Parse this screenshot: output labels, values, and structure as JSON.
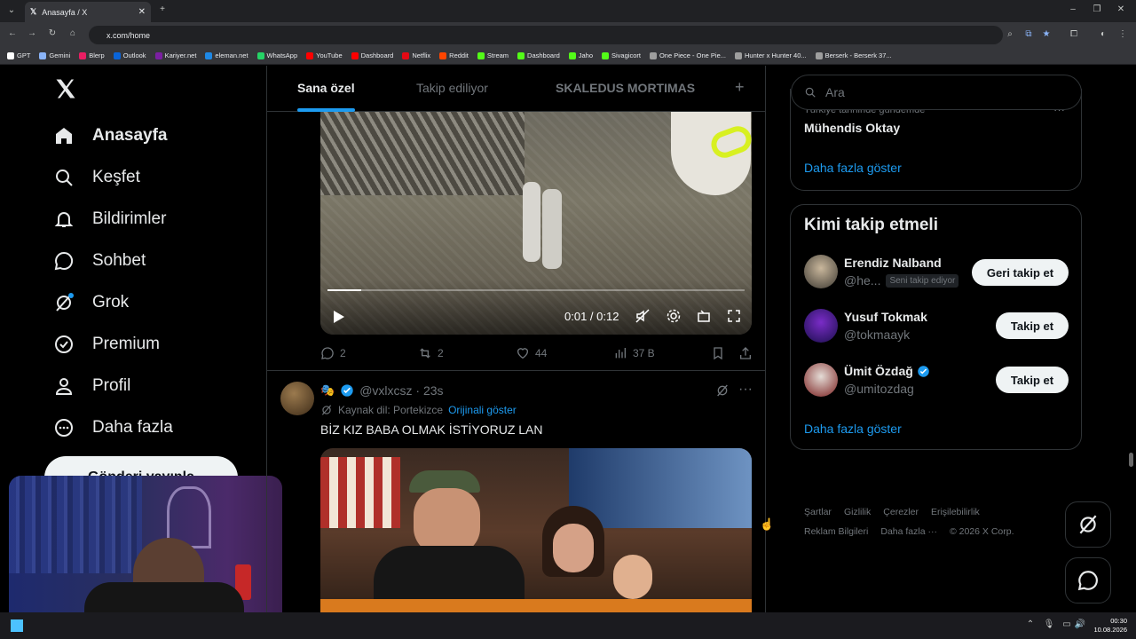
{
  "browser": {
    "tab_title": "Anasayfa / X",
    "url": "x.com/home",
    "bookmarks": [
      {
        "label": "GPT",
        "color": "#ffffff"
      },
      {
        "label": "Gemini",
        "color": "#8ab4f8"
      },
      {
        "label": "Blerp",
        "color": "#e91e63"
      },
      {
        "label": "Outlook",
        "color": "#0a64d8"
      },
      {
        "label": "Kariyer.net",
        "color": "#7b1fa2"
      },
      {
        "label": "eleman.net",
        "color": "#1e88e5"
      },
      {
        "label": "WhatsApp",
        "color": "#25d366"
      },
      {
        "label": "YouTube",
        "color": "#ff0000"
      },
      {
        "label": "Dashboard",
        "color": "#ff0000"
      },
      {
        "label": "Netflix",
        "color": "#e50914"
      },
      {
        "label": "Reddit",
        "color": "#ff4500"
      },
      {
        "label": "Stream",
        "color": "#53fc18"
      },
      {
        "label": "Dashboard",
        "color": "#53fc18"
      },
      {
        "label": "Jaho",
        "color": "#53fc18"
      },
      {
        "label": "Sivagicort",
        "color": "#53fc18"
      },
      {
        "label": "One Piece - One Pie...",
        "color": "#9e9e9e"
      },
      {
        "label": "Hunter x Hunter 40...",
        "color": "#9e9e9e"
      },
      {
        "label": "Berserk - Berserk 37...",
        "color": "#9e9e9e"
      }
    ]
  },
  "nav": {
    "home": "Anasayfa",
    "explore": "Keşfet",
    "notifications": "Bildirimler",
    "chat": "Sohbet",
    "grok": "Grok",
    "premium": "Premium",
    "profile": "Profil",
    "more": "Daha fazla",
    "post_button": "Gönderi yayınla"
  },
  "timeline_tabs": {
    "for_you": "Sana özel",
    "following": "Takip ediliyor",
    "list": "SKALEDUS MORTIMAS"
  },
  "post1": {
    "video_time": "0:01 / 0:12",
    "progress": 0.08,
    "replies": "2",
    "reposts": "2",
    "likes": "44",
    "views": "37 B"
  },
  "post2": {
    "handle": "@vxlxcsz · 23s",
    "source_lang": "Kaynak dil: Portekizce",
    "show_original": "Orijinali göster",
    "text": "BİZ KIZ BABA OLMAK İSTİYORUZ LAN"
  },
  "sidebar": {
    "search_placeholder": "Ara",
    "trend_context": "Türkiye tarihinde gündemde",
    "trend_name": "Mühendis Oktay",
    "show_more_1": "Daha fazla göster",
    "wtf_title": "Kimi takip etmeli",
    "suggestions": [
      {
        "name": "Erendiz Nalband",
        "handle": "@he...",
        "badge": "Seni takip ediyor",
        "button": "Geri takip et"
      },
      {
        "name": "Yusuf Tokmak",
        "handle": "@tokmaayk",
        "button": "Takip et"
      },
      {
        "name": "Ümit Özdağ",
        "handle": "@umitozdag",
        "button": "Takip et"
      }
    ],
    "show_more_2": "Daha fazla göster",
    "footer": [
      "Şartlar",
      "Gizlilik",
      "Çerezler",
      "Erişilebilirlik",
      "Reklam Bilgileri",
      "Daha fazla ···",
      "© 2026 X Corp."
    ]
  },
  "taskbar": {
    "time": "00:30",
    "date": "10.08.2026"
  },
  "colors": {
    "accent": "#1d9bf0",
    "background": "#000000",
    "border": "#2f3336"
  }
}
